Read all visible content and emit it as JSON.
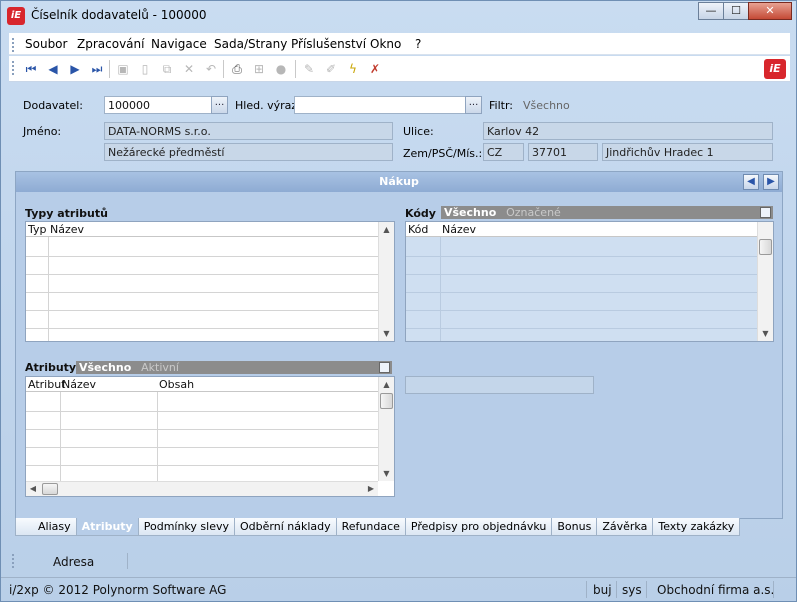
{
  "window": {
    "title": "Číselník dodavatelů - 100000",
    "app_icon": "iE",
    "min": "—",
    "max": "☐",
    "close": "✕"
  },
  "menu": [
    "Soubor",
    "Zpracování",
    "Navigace",
    "Sada/Strany",
    "Příslušenství",
    "Okno",
    "?"
  ],
  "form": {
    "dodavatel_label": "Dodavatel:",
    "dodavatel_value": "100000",
    "dots": "...",
    "hled_label": "Hled. výraz:",
    "hled_value": "",
    "filtr_label": "Filtr:",
    "filtr_value": "Všechno",
    "jmeno_label": "Jméno:",
    "jmeno_1": "DATA-NORMS s.r.o.",
    "jmeno_2": "Nežárecké předměstí",
    "ulice_label": "Ulice:",
    "ulice_value": "Karlov 42",
    "zem_label": "Zem/PSČ/Mís.:",
    "zem_value": "CZ",
    "psc_value": "37701",
    "misto_value": "Jindřichův Hradec 1"
  },
  "panel": {
    "title": "Nákup",
    "prev": "◀",
    "next": "▶",
    "typy_title": "Typy atributů",
    "typy_cols": [
      "Typ",
      "Název"
    ],
    "kody_title": "Kódy",
    "kody_filter_on": "Všechno",
    "kody_filter_off": "Označené",
    "kody_cols": [
      "Kód",
      "Název"
    ],
    "atributy_title": "Atributy",
    "atr_filter_on": "Všechno",
    "atr_filter_off": "Aktivní",
    "atr_cols": [
      "Atribut",
      "Název",
      "Obsah"
    ]
  },
  "tabs": [
    "Aliasy",
    "Atributy",
    "Podmínky slevy",
    "Odběrní náklady",
    "Refundace",
    "Předpisy pro objednávku",
    "Bonus",
    "Závěrka",
    "Texty zakázky"
  ],
  "active_tab": "Atributy",
  "bottom": {
    "adresa": "Adresa"
  },
  "status": {
    "copyright": "i/2xp © 2012 Polynorm Software AG",
    "user": "buj",
    "db": "sys",
    "firm": "Obchodní firma a.s."
  }
}
